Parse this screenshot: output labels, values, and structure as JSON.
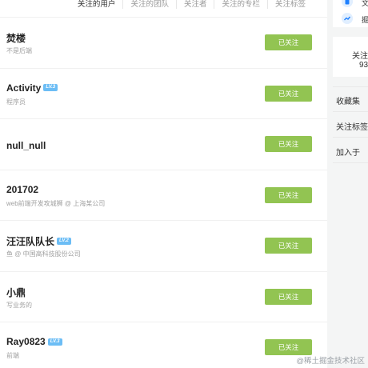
{
  "tabs": [
    "关注的用户",
    "关注的团队",
    "关注者",
    "关注的专栏",
    "关注标签"
  ],
  "active_tab": 0,
  "follow_button_label": "已关注",
  "users": [
    {
      "name": "焚楼",
      "level": "",
      "desc": "不是后端"
    },
    {
      "name": "Activity",
      "level": "LV.3",
      "desc": "程序员"
    },
    {
      "name": "null_null",
      "level": "",
      "desc": ""
    },
    {
      "name": "201702",
      "level": "",
      "desc": "web前端开发攻城狮 @ 上海某公司"
    },
    {
      "name": "汪汪队队长",
      "level": "LV.2",
      "desc": "鱼 @ 中国高科技股份公司"
    },
    {
      "name": "小鼎",
      "level": "",
      "desc": "写业务的"
    },
    {
      "name": "Ray0823",
      "level": "LV.3",
      "desc": "前端"
    }
  ],
  "sidebar": {
    "top_items": [
      "文",
      "掘"
    ],
    "stat_label": "关注",
    "stat_value": "93",
    "menu": [
      "收藏集",
      "关注标签",
      "加入于"
    ]
  },
  "watermark": "@稀土掘金技术社区",
  "colors": {
    "follow_button": "#92c452",
    "level_badge": "#6cbdf5"
  }
}
